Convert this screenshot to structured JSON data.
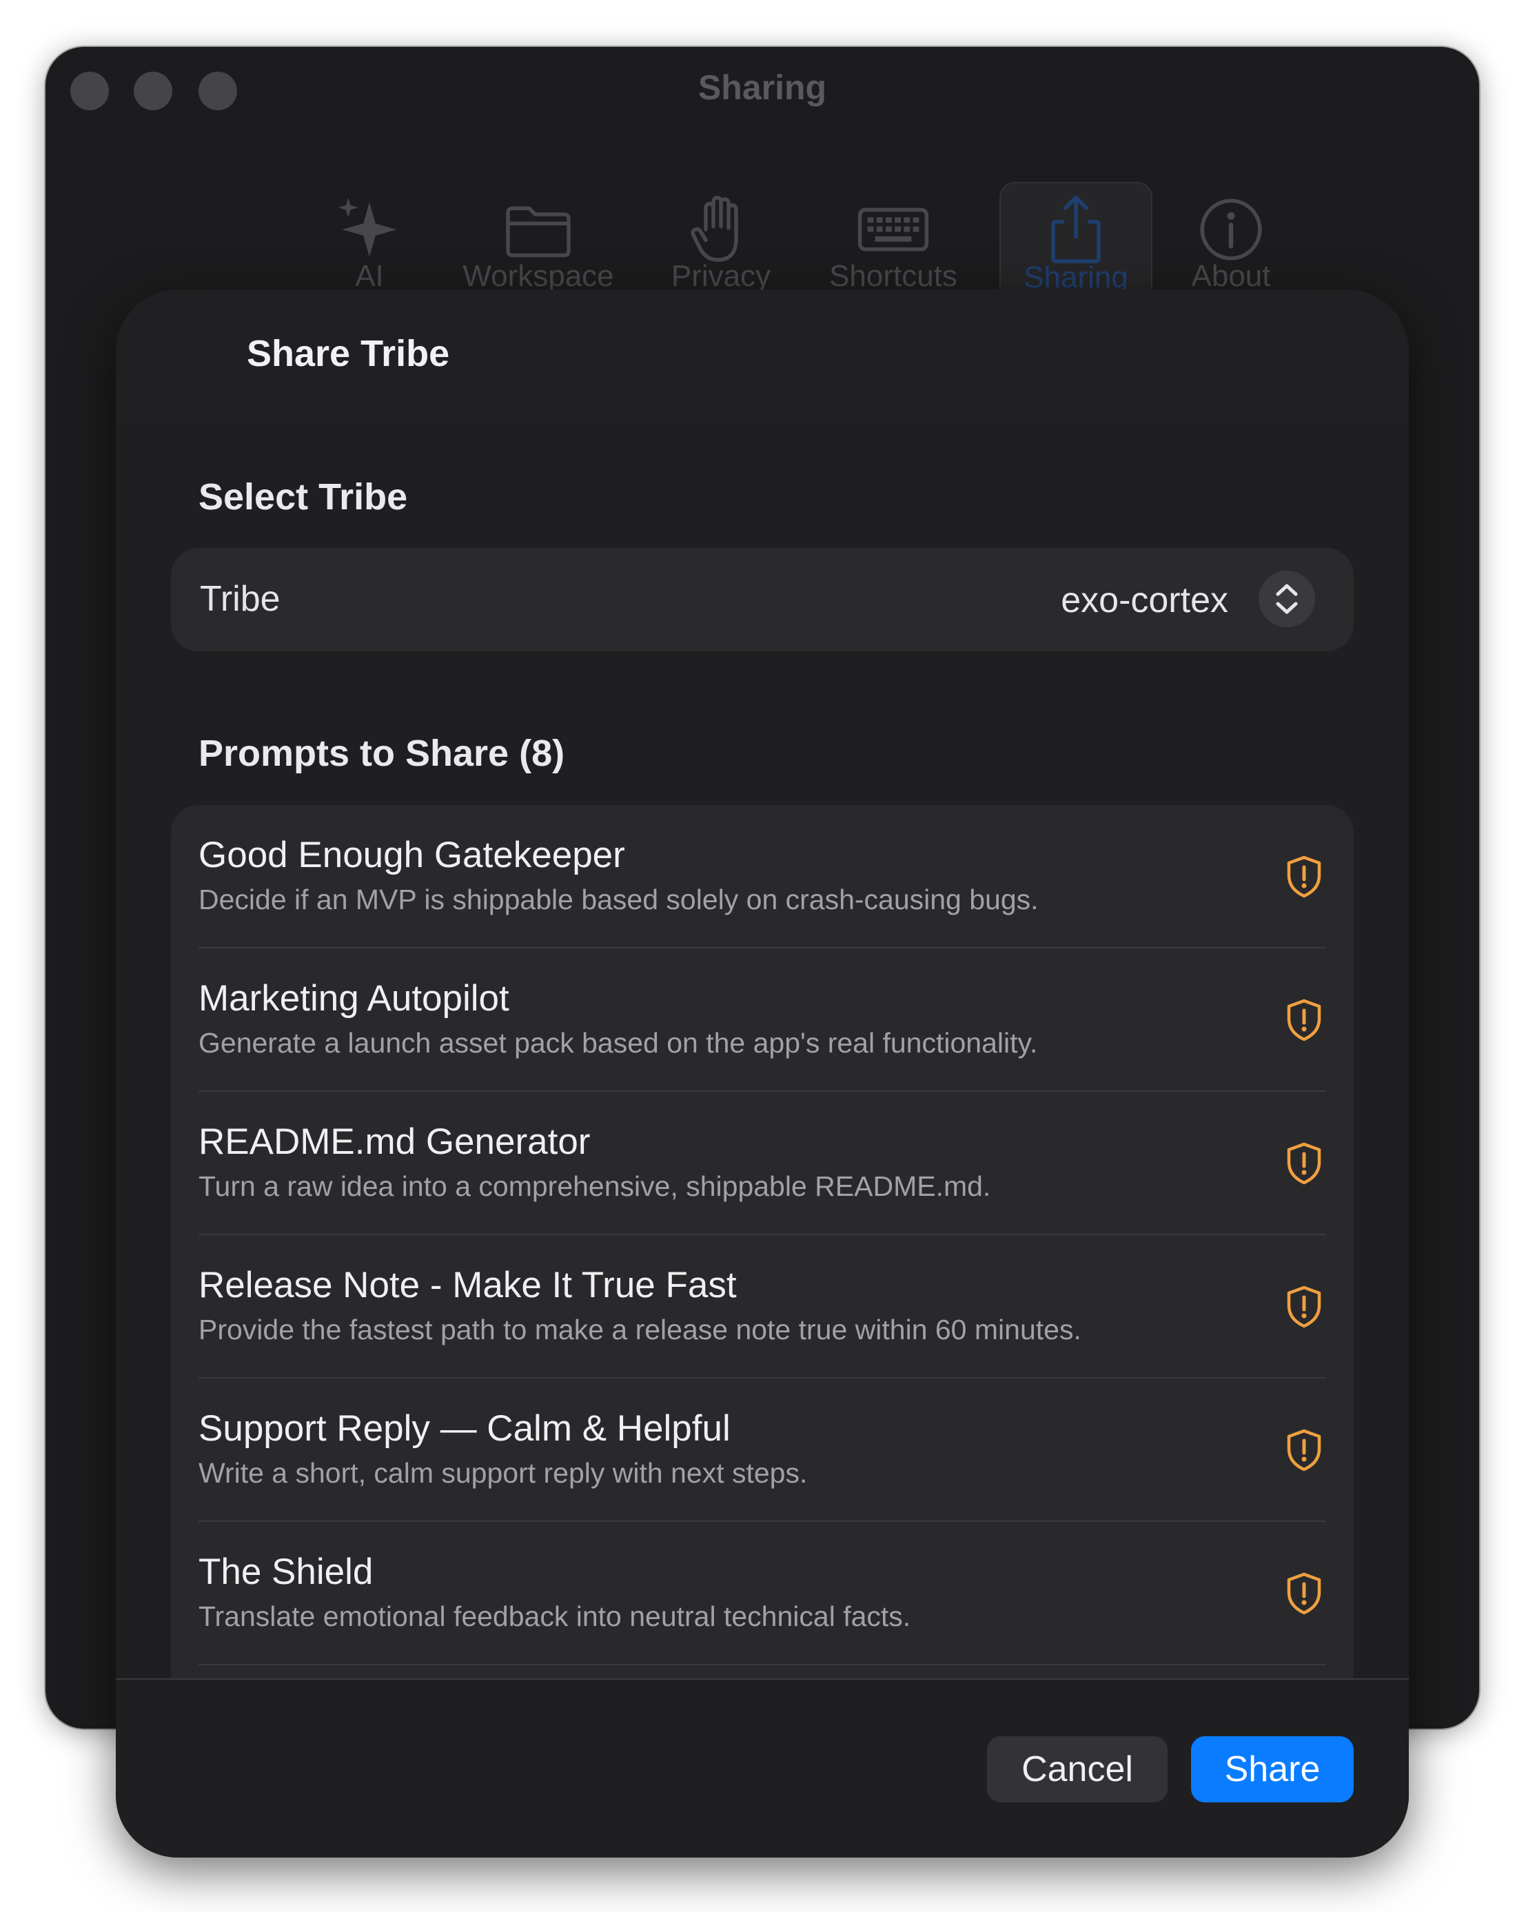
{
  "window": {
    "title": "Sharing",
    "toolbar": [
      {
        "label": "AI",
        "icon": "sparkles-icon"
      },
      {
        "label": "Workspace",
        "icon": "folder-icon"
      },
      {
        "label": "Privacy",
        "icon": "hand-icon"
      },
      {
        "label": "Shortcuts",
        "icon": "keyboard-icon"
      },
      {
        "label": "Sharing",
        "icon": "share-icon",
        "selected": true
      },
      {
        "label": "About",
        "icon": "info-icon"
      }
    ]
  },
  "sheet": {
    "title": "Share Tribe",
    "select_section": "Select Tribe",
    "tribe_label": "Tribe",
    "tribe_value": "exo-cortex",
    "prompts_section": "Prompts to Share (8)",
    "prompts": [
      {
        "title": "Good Enough Gatekeeper",
        "description": "Decide if an MVP is shippable based solely on crash-causing bugs."
      },
      {
        "title": "Marketing Autopilot",
        "description": "Generate a launch asset pack based on the app's real functionality."
      },
      {
        "title": "README.md Generator",
        "description": "Turn a raw idea into a comprehensive, shippable README.md."
      },
      {
        "title": "Release Note - Make It True Fast",
        "description": "Provide the fastest path to make a release note true within 60 minutes."
      },
      {
        "title": "Support Reply — Calm & Helpful",
        "description": "Write a short, calm support reply with next steps."
      },
      {
        "title": "The Shield",
        "description": "Translate emotional feedback into neutral technical facts."
      }
    ],
    "cancel_label": "Cancel",
    "share_label": "Share"
  },
  "colors": {
    "accent": "#0a7cff",
    "warning": "#f0a040"
  }
}
